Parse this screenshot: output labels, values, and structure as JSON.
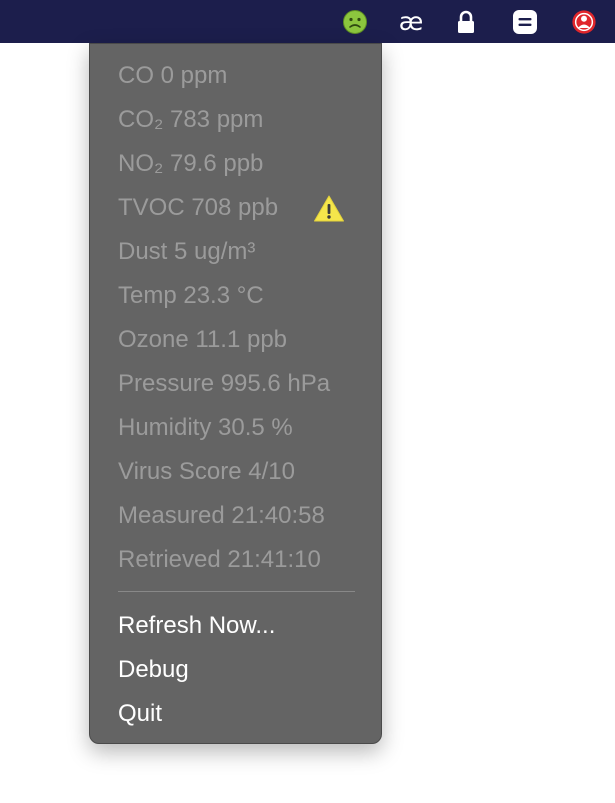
{
  "menubar": {
    "icons": [
      "sick-face-icon",
      "ae-ligature-icon",
      "lock-icon",
      "menu-lines-icon",
      "red-status-icon"
    ],
    "ae_text": "æ"
  },
  "menu": {
    "readings": [
      {
        "label": "CO 0 ppm"
      },
      {
        "label": "CO₂ 783 ppm"
      },
      {
        "label": "NO₂ 79.6 ppb"
      },
      {
        "label": "TVOC 708 ppb",
        "warning_icon": "warning-icon"
      },
      {
        "label": "Dust 5 ug/m³"
      },
      {
        "label": "Temp 23.3 °C"
      },
      {
        "label": "Ozone 11.1 ppb"
      },
      {
        "label": "Pressure 995.6 hPa"
      },
      {
        "label": "Humidity 30.5 %"
      },
      {
        "label": "Virus Score 4/10"
      },
      {
        "label": "Measured 21:40:58"
      },
      {
        "label": "Retrieved 21:41:10"
      }
    ],
    "actions": [
      {
        "label": "Refresh Now..."
      },
      {
        "label": "Debug"
      },
      {
        "label": "Quit"
      }
    ]
  },
  "colors": {
    "menubar_bg": "#1c1e4c",
    "menu_bg": "#646464",
    "disabled_text": "#9b9b9b",
    "enabled_text": "#ffffff",
    "warning": "#f5e64b"
  }
}
